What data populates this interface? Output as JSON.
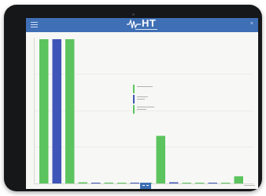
{
  "header": {
    "logo_text": "HT",
    "menu_icon": "menu-icon",
    "close_icon": "close-icon"
  },
  "legend": {
    "items": [
      {
        "color": "#5cc45e"
      },
      {
        "color": "#4055b8"
      },
      {
        "color": "#5cc45e"
      }
    ]
  },
  "chart_data": {
    "type": "bar",
    "colors": {
      "green": "#5cc45e",
      "blue": "#4055b8"
    },
    "ylim": [
      0,
      100
    ],
    "grid": true,
    "legend_position": "center",
    "bars": [
      {
        "slot": 0,
        "value": 100,
        "color": "green"
      },
      {
        "slot": 1,
        "value": 100,
        "color": "blue"
      },
      {
        "slot": 2,
        "value": 100,
        "color": "green"
      },
      {
        "slot": 3,
        "value": 0.8,
        "color": "green"
      },
      {
        "slot": 4,
        "value": 0.5,
        "color": "blue"
      },
      {
        "slot": 5,
        "value": 0.6,
        "color": "green"
      },
      {
        "slot": 6,
        "value": 0.3,
        "color": "green"
      },
      {
        "slot": 7,
        "value": 0.2,
        "color": "blue"
      },
      {
        "slot": 8,
        "value": 0.3,
        "color": "green"
      },
      {
        "slot": 9,
        "value": 33,
        "color": "green"
      },
      {
        "slot": 10,
        "value": 0.8,
        "color": "blue"
      },
      {
        "slot": 11,
        "value": 0.4,
        "color": "green"
      },
      {
        "slot": 12,
        "value": 0.3,
        "color": "green"
      },
      {
        "slot": 13,
        "value": 0.2,
        "color": "blue"
      },
      {
        "slot": 14,
        "value": 0.3,
        "color": "green"
      },
      {
        "slot": 15,
        "value": 5,
        "color": "green"
      }
    ]
  }
}
